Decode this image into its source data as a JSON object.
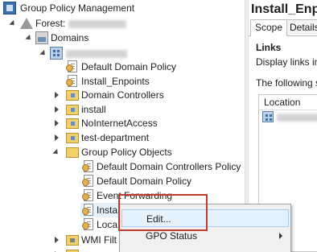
{
  "tree": {
    "root": "Group Policy Management",
    "forest_label": "Forest:",
    "domains": "Domains",
    "items_domain_children": [
      {
        "label": "Default Domain Policy",
        "icon": "gpo-link-icon"
      },
      {
        "label": "Install_Enpoints",
        "icon": "gpo-link-icon"
      },
      {
        "label": "Domain Controllers",
        "icon": "ou-folder-icon"
      },
      {
        "label": "install",
        "icon": "ou-folder-icon"
      },
      {
        "label": "NoInternetAccess",
        "icon": "ou-folder-icon"
      },
      {
        "label": "test-department",
        "icon": "ou-folder-icon"
      },
      {
        "label": "Group Policy Objects",
        "icon": "folder-icon"
      }
    ],
    "gpo_children": [
      {
        "label": "Default Domain Controllers Policy"
      },
      {
        "label": "Default Domain Policy"
      },
      {
        "label": "Event Forwarding"
      },
      {
        "label": "Insta"
      },
      {
        "label": "Loca"
      }
    ],
    "wmi": "WMI Filt"
  },
  "right": {
    "title": "Install_Enpo",
    "tabs": [
      "Scope",
      "Details"
    ],
    "links_heading": "Links",
    "links_desc": "Display links in t",
    "following": "The following sit",
    "location_header": "Location"
  },
  "context_menu": {
    "items": [
      "Edit...",
      "GPO Status"
    ]
  },
  "colors": {
    "highlight": "#c0392b",
    "hover": "#e5f1fb"
  }
}
